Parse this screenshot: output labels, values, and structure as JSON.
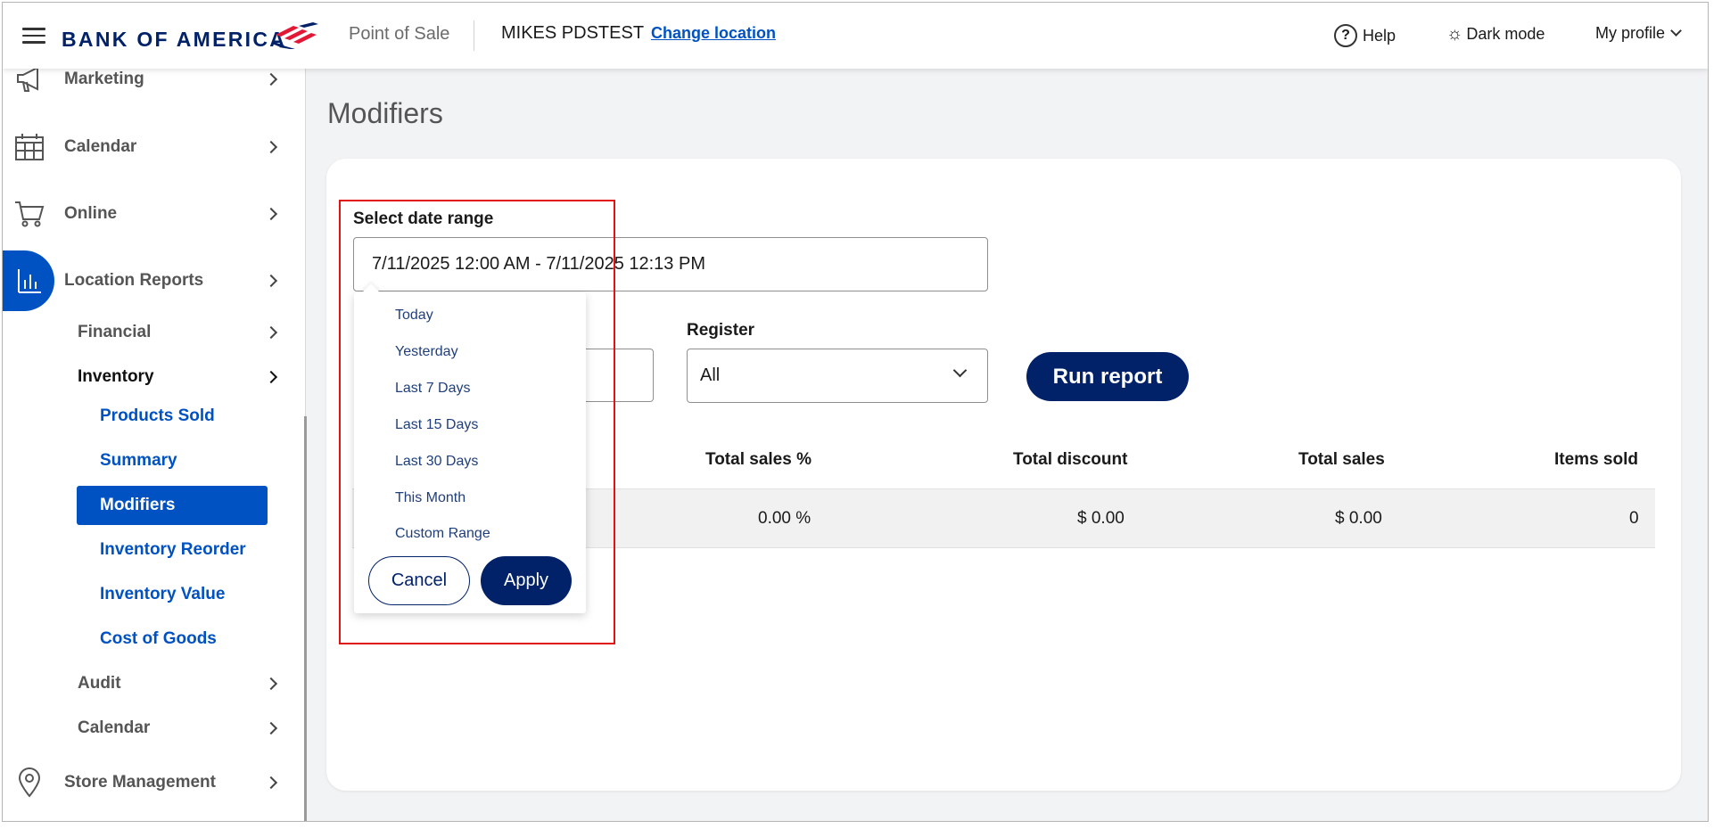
{
  "header": {
    "brand": "BANK OF AMERICA",
    "app_name": "Point of Sale",
    "location_name": "MIKES PDSTEST",
    "change_location": "Change location",
    "help": "Help",
    "dark_mode": "Dark mode",
    "my_profile": "My profile"
  },
  "sidebar": {
    "items": [
      {
        "label": "Marketing",
        "icon": "megaphone-icon"
      },
      {
        "label": "Calendar",
        "icon": "calendar-icon"
      },
      {
        "label": "Online",
        "icon": "cart-icon"
      },
      {
        "label": "Location Reports",
        "icon": "bar-chart-icon"
      },
      {
        "label": "Store Management",
        "icon": "location-pin-icon"
      }
    ],
    "report_groups": {
      "financial": "Financial",
      "inventory": "Inventory",
      "audit": "Audit",
      "calendar": "Calendar"
    },
    "inventory_items": [
      "Products Sold",
      "Summary",
      "Modifiers",
      "Inventory Reorder",
      "Inventory Value",
      "Cost of Goods"
    ],
    "selected_item": "Modifiers"
  },
  "main": {
    "title": "Modifiers",
    "date_range_label": "Select date range",
    "date_range_value": "7/11/2025 12:00 AM - 7/11/2025 12:13 PM",
    "register_label": "Register",
    "register_value": "All",
    "run_report": "Run report",
    "table": {
      "columns": [
        "Total sales %",
        "Total discount",
        "Total sales",
        "Items sold"
      ],
      "rows": [
        [
          "0.00 %",
          "$ 0.00",
          "$ 0.00",
          "0"
        ]
      ]
    }
  },
  "date_dropdown": {
    "options": [
      "Today",
      "Yesterday",
      "Last 7 Days",
      "Last 15 Days",
      "Last 30 Days",
      "This Month",
      "Custom Range"
    ],
    "cancel": "Cancel",
    "apply": "Apply"
  },
  "colors": {
    "brand_navy": "#012169",
    "link_blue": "#0052c2",
    "highlight_red": "#e01212"
  }
}
